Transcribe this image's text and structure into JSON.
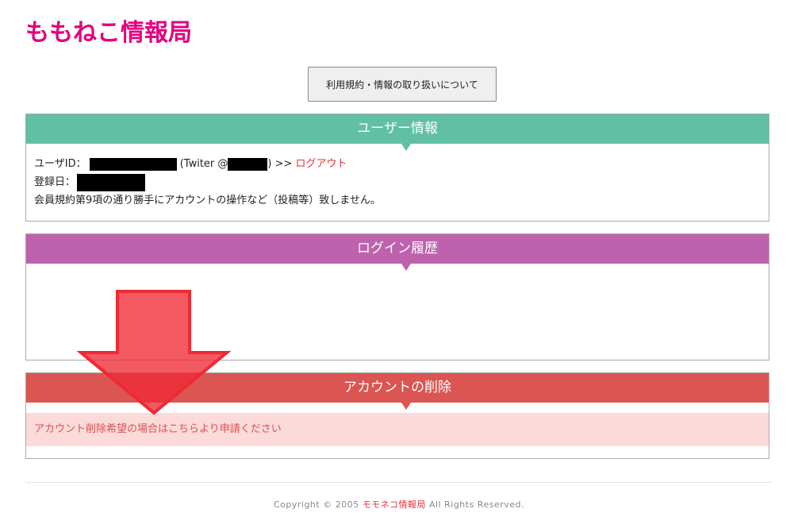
{
  "site": {
    "title": "ももねこ情報局"
  },
  "terms_button": {
    "label": "利用規約・情報の取り扱いについて"
  },
  "user_panel": {
    "title": "ユーザー情報",
    "user_id_label": "ユーザID：",
    "twitter_prefix": "(Twiter @",
    "twitter_suffix": ") >> ",
    "logout_label": "ログアウト",
    "registered_label": "登録日：",
    "notice": "会員規約第9項の通り勝手にアカウントの操作など（投稿等）致しません。"
  },
  "login_history_panel": {
    "title": "ログイン履歴"
  },
  "delete_panel": {
    "title": "アカウントの削除",
    "alert_text": "アカウント削除希望の場合はこちらより申請ください"
  },
  "footer": {
    "prefix": "Copyright © 2005 ",
    "brand": "モモネコ情報局",
    "suffix": " All Rights Reserved."
  },
  "colors": {
    "brand": "#e4007f",
    "user_header": "#61bfa4",
    "login_header": "#bf62ad",
    "delete_header": "#db5552",
    "alert_bg": "#fcdada",
    "link": "#e0333e",
    "annotation_arrow": "#ee2a35"
  },
  "icons": {
    "annotation": "down-arrow-icon"
  }
}
